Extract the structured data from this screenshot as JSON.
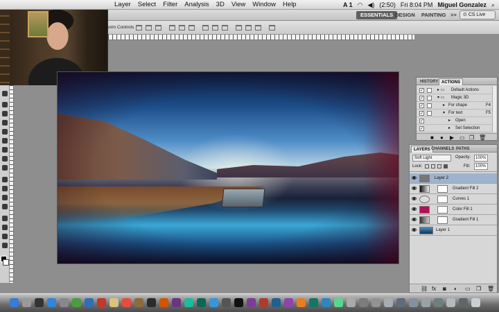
{
  "menubar": {
    "items": [
      "Layer",
      "Select",
      "Filter",
      "Analysis",
      "3D",
      "View",
      "Window",
      "Help"
    ],
    "status": {
      "adobe_badge": "A 1",
      "battery": "(2:50)",
      "datetime": "Fri 8:04 PM",
      "user": "Miguel Gonzalez"
    }
  },
  "workspace": {
    "essentials": "ESSENTIALS",
    "design": "DESIGN",
    "painting": "PAINTING",
    "more": ">>",
    "cs_live": "CS Live"
  },
  "options_bar": {
    "transform_controls": "orm Controls"
  },
  "actions_panel": {
    "tabs": [
      "HISTORY",
      "ACTIONS"
    ],
    "rows": [
      {
        "label": "Default Actions",
        "shortcut": ""
      },
      {
        "label": "Magic 3D",
        "shortcut": ""
      },
      {
        "label": "For shape",
        "shortcut": "F4"
      },
      {
        "label": "For text",
        "shortcut": "F5"
      },
      {
        "label": "Open",
        "shortcut": ""
      },
      {
        "label": "Set Selection",
        "shortcut": ""
      }
    ]
  },
  "layers_panel": {
    "tabs": [
      "LAYERS",
      "CHANNELS",
      "PATHS"
    ],
    "blend_mode": "Soft Light",
    "opacity_label": "Opacity:",
    "opacity_value": "100%",
    "lock_label": "Lock:",
    "fill_label": "Fill:",
    "fill_value": "100%",
    "layers": [
      {
        "name": "Layer 2",
        "selected": true
      },
      {
        "name": "Gradient Fill 2",
        "selected": false
      },
      {
        "name": "Curves 1",
        "selected": false
      },
      {
        "name": "Color Fill 1",
        "selected": false
      },
      {
        "name": "Gradient Fill 1",
        "selected": false
      },
      {
        "name": "Layer 1",
        "selected": false
      }
    ]
  },
  "colors": {
    "accent": "#5f5f5f",
    "selection": "#9fb4cc",
    "foreground": "#000000",
    "background": "#ffffff",
    "color_fill": "#b3105a"
  },
  "dock_icons": [
    "finder-icon",
    "launchpad-icon",
    "mission-control-icon",
    "safari-icon",
    "chrome-icon",
    "firefox-icon",
    "mail-icon",
    "notes-icon",
    "calendar-icon",
    "contacts-icon",
    "itunes-icon",
    "app-store-icon",
    "photoshop-icon",
    "illustrator-icon",
    "after-effects-icon",
    "trash-icon"
  ]
}
